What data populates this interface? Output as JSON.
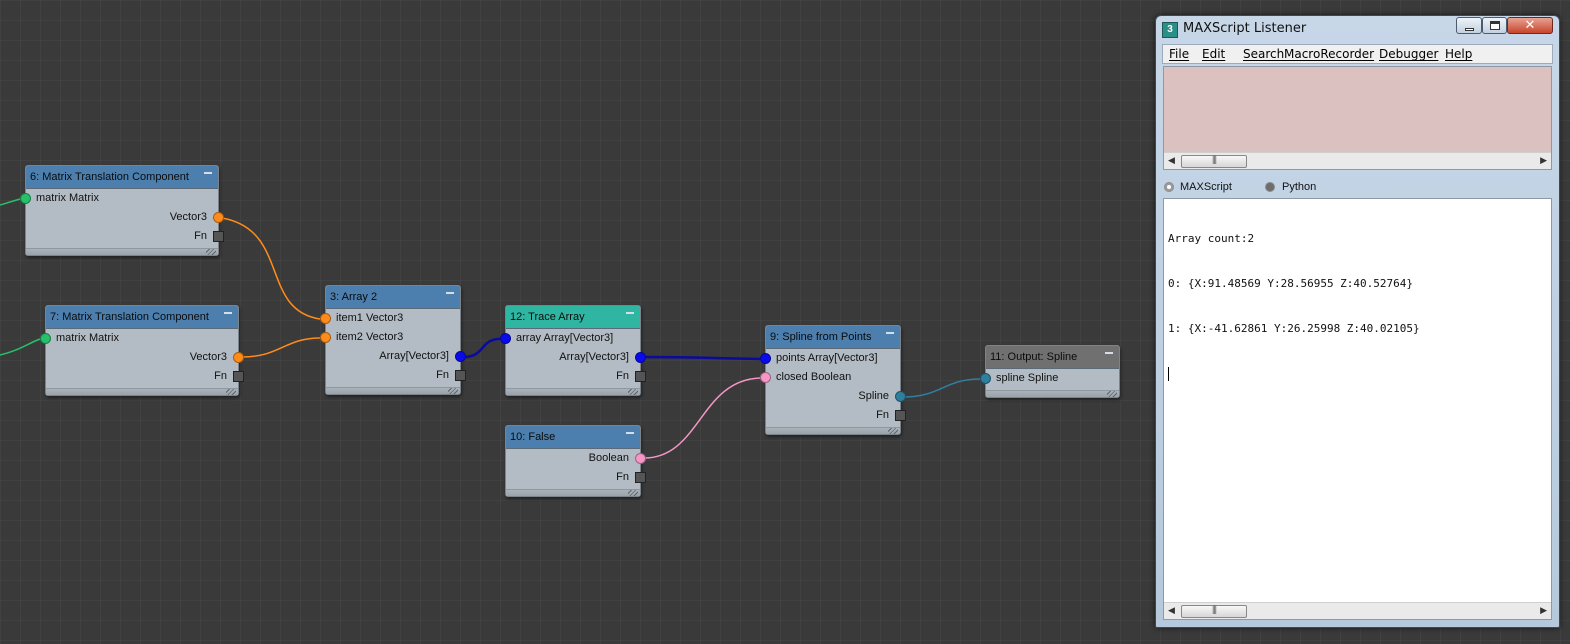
{
  "graph": {
    "colors": {
      "matrix": "#26c06a",
      "vector3": "#ff8c1a",
      "array": "#0a0aea",
      "boolean": "#f596c6",
      "spline": "#2f7e9e",
      "header_blue": "#4c7fae",
      "header_teal": "#2fb6a2",
      "header_gray": "#707070"
    },
    "nodes": {
      "n6": {
        "title": "6: Matrix Translation Component",
        "in_matrix": "matrix Matrix",
        "out_vector3": "Vector3",
        "fn": "Fn"
      },
      "n7": {
        "title": "7: Matrix Translation Component",
        "in_matrix": "matrix Matrix",
        "out_vector3": "Vector3",
        "fn": "Fn"
      },
      "n3": {
        "title": "3: Array 2",
        "in_item1": "item1 Vector3",
        "in_item2": "item2 Vector3",
        "out_array": "Array[Vector3]",
        "fn": "Fn"
      },
      "n12": {
        "title": "12: Trace Array",
        "in_array": "array Array[Vector3]",
        "out_array": "Array[Vector3]",
        "fn": "Fn"
      },
      "n10": {
        "title": "10: False",
        "out_boolean": "Boolean",
        "fn": "Fn"
      },
      "n9": {
        "title": "9: Spline from Points",
        "in_points": "points Array[Vector3]",
        "in_closed": "closed Boolean",
        "out_spline": "Spline",
        "fn": "Fn"
      },
      "n11": {
        "title": "11: Output: Spline",
        "in_spline": "spline Spline"
      }
    }
  },
  "listener": {
    "title": "MAXScript Listener",
    "icon_glyph": "3",
    "menu": {
      "file": "File",
      "edit": "Edit",
      "search": "Search",
      "macrorecorder": "MacroRecorder",
      "debugger": "Debugger",
      "help": "Help"
    },
    "language_options": {
      "maxscript": "MAXScript",
      "python": "Python"
    },
    "output_lines": [
      "Array count:2",
      "0: {X:91.48569 Y:28.56955 Z:40.52764}",
      "1: {X:-41.62861 Y:26.25998 Z:40.02105}"
    ]
  }
}
